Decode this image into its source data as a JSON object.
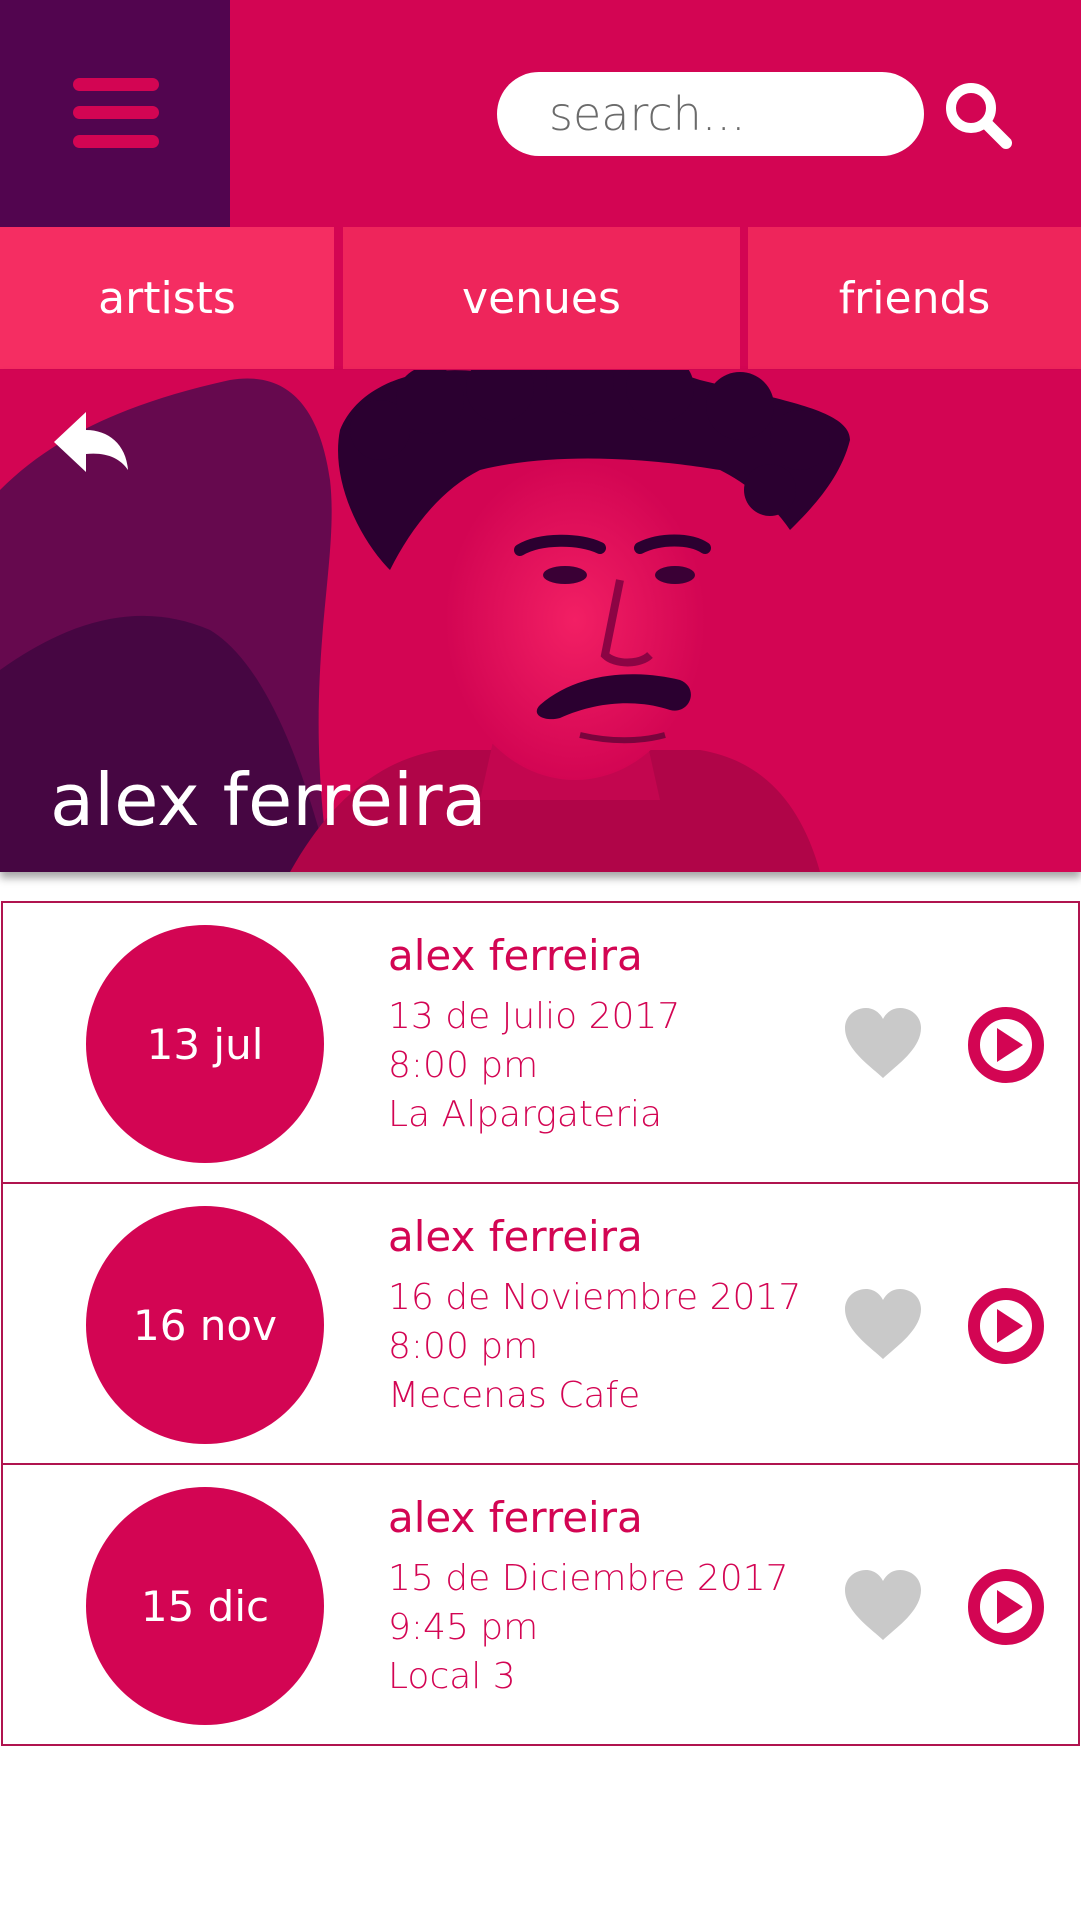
{
  "header": {
    "search": {
      "placeholder": "search...",
      "value": ""
    },
    "menu_icon": "hamburger-menu-icon",
    "search_icon": "magnifier-icon"
  },
  "tabs": [
    {
      "label": "artists"
    },
    {
      "label": "venues"
    },
    {
      "label": "friends"
    }
  ],
  "artist": {
    "name": "alex ferreira"
  },
  "events": [
    {
      "date_badge": "13 jul",
      "title": "alex ferreira",
      "date_full": "13 de Julio 2017",
      "time": "8:00 pm",
      "venue": "La Alpargateria"
    },
    {
      "date_badge": "16 nov",
      "title": "alex ferreira",
      "date_full": "16 de Noviembre 2017",
      "time": "8:00 pm",
      "venue": "Mecenas Cafe"
    },
    {
      "date_badge": "15 dic",
      "title": "alex ferreira",
      "date_full": "15 de Diciembre 2017",
      "time": "9:45 pm",
      "venue": "Local 3"
    }
  ],
  "colors": {
    "primary": "#d30553",
    "menu_block": "#52054f",
    "tab_active": "#f52d62",
    "tab": "#ee255b",
    "heart": "#c9c9c9",
    "white": "#ffffff"
  }
}
